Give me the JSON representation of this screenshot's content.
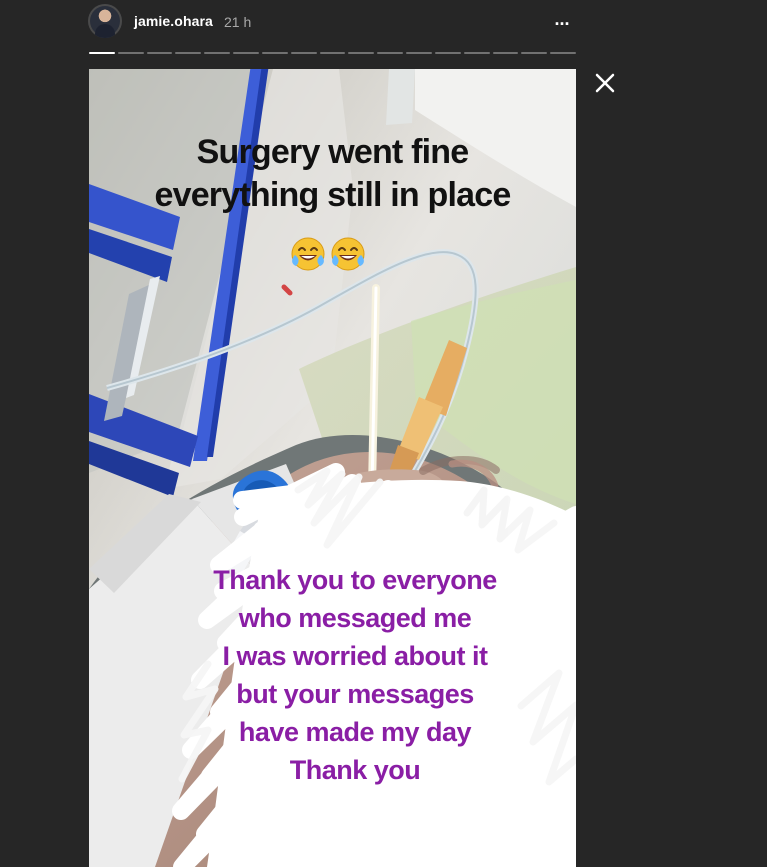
{
  "story": {
    "username": "jamie.ohara",
    "timestamp": "21 h",
    "more_label": "...",
    "close_label": "×",
    "progress": {
      "total_segments": 17,
      "active_segment": 1
    },
    "top_caption": {
      "line1": "Surgery went fine",
      "line2": "everything still in place"
    },
    "emoji": {
      "count": 2,
      "name": "face-with-tears-of-joy"
    },
    "bottom_caption": {
      "line1": "Thank you to everyone",
      "line2": "who messaged me",
      "line3": "I was worried about it",
      "line4": "but your messages",
      "line5": "have made my day",
      "line6": "Thank you"
    }
  },
  "colors": {
    "background": "#262626",
    "top_text": "#111111",
    "bottom_text": "#8a1ea5",
    "scribble": "#ffffff",
    "iv_cap": "#2a74d8",
    "iv_tube": "#dfe7ee",
    "connector": "#e9b46c",
    "blanket": "#d9e2b8"
  }
}
